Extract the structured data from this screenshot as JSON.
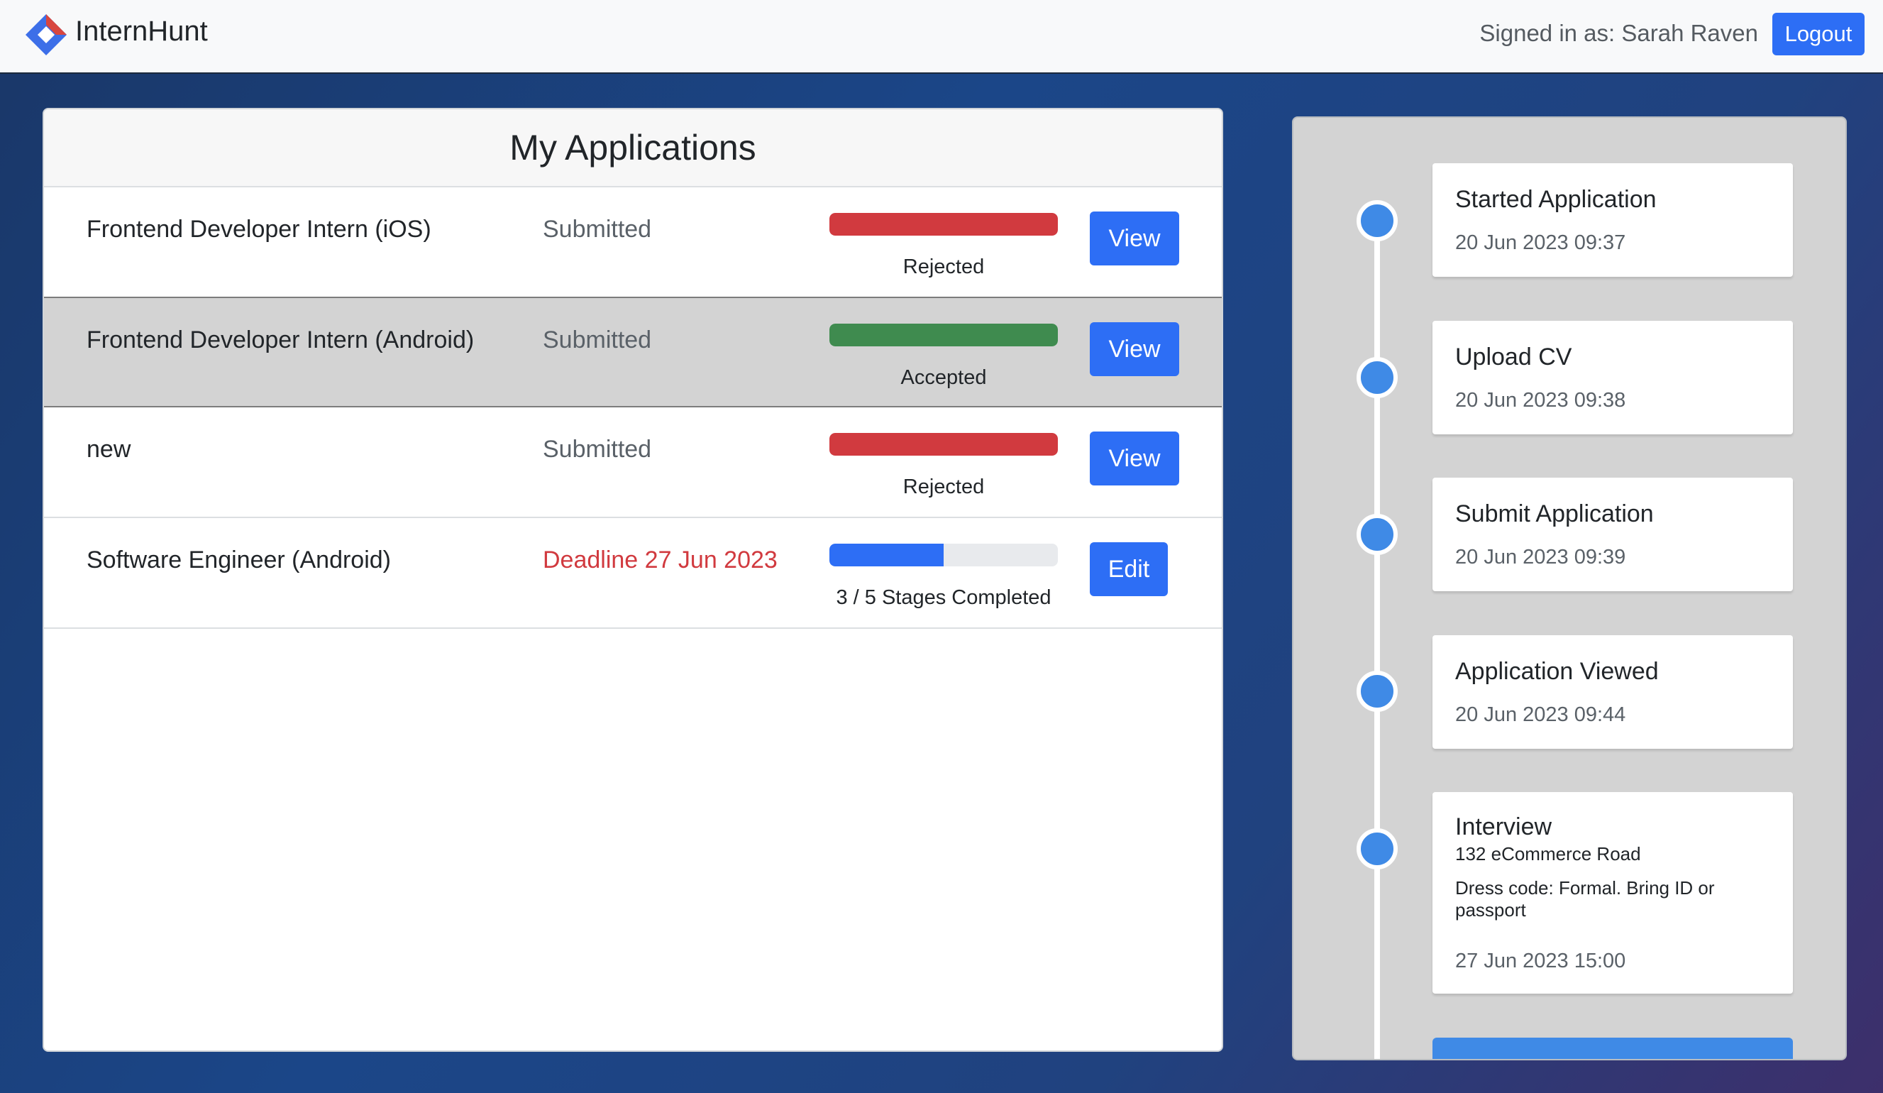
{
  "navbar": {
    "brand": "InternHunt",
    "signed_in": "Signed in as: Sarah Raven",
    "logout_label": "Logout"
  },
  "colors": {
    "primary": "#2d6ef5",
    "rejected": "#d13a3f",
    "accepted": "#3f8b4f",
    "timeline_dot": "#3f8ae6"
  },
  "applications": {
    "title": "My Applications",
    "rows": [
      {
        "name": "Frontend Developer Intern (iOS)",
        "status": "Submitted",
        "progress_label": "Rejected",
        "progress_percent": 100,
        "button": "View"
      },
      {
        "name": "Frontend Developer Intern (Android)",
        "status": "Submitted",
        "progress_label": "Accepted",
        "progress_percent": 100,
        "button": "View"
      },
      {
        "name": "new",
        "status": "Submitted",
        "progress_label": "Rejected",
        "progress_percent": 100,
        "button": "View"
      },
      {
        "name": "Software Engineer (Android)",
        "status": "Deadline 27 Jun 2023",
        "progress_label": "3 / 5 Stages Completed",
        "progress_percent": 50,
        "button": "Edit"
      }
    ]
  },
  "timeline": {
    "events": [
      {
        "title": "Started Application",
        "date": "20 Jun 2023 09:37"
      },
      {
        "title": "Upload CV",
        "date": "20 Jun 2023 09:38"
      },
      {
        "title": "Submit Application",
        "date": "20 Jun 2023 09:39"
      },
      {
        "title": "Application Viewed",
        "date": "20 Jun 2023 09:44"
      },
      {
        "title": "Interview",
        "location": "132 eCommerce Road",
        "note": "Dress code: Formal. Bring ID or passport",
        "date": "27 Jun 2023 15:00"
      }
    ]
  }
}
